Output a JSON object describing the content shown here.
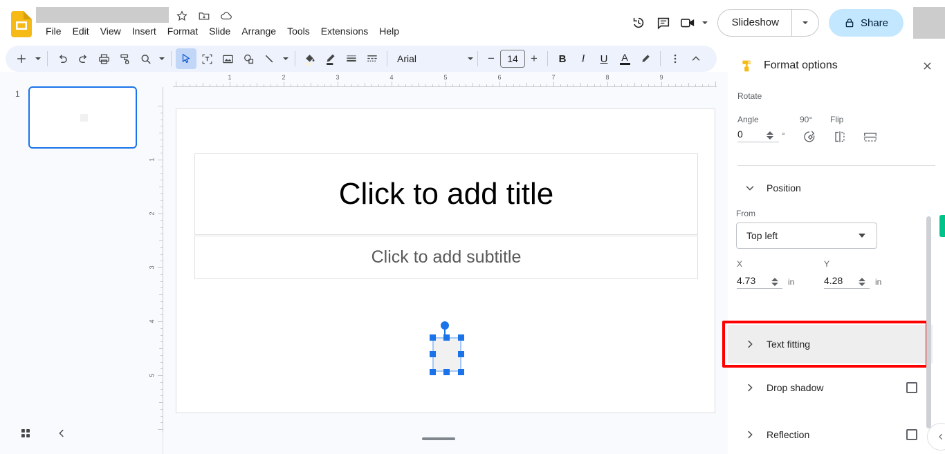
{
  "app": {
    "name": "Google Slides",
    "title_redacted": true
  },
  "header": {
    "icons": [
      {
        "name": "star-icon",
        "glyph": "☆"
      },
      {
        "name": "move-to-folder-icon",
        "glyph": "folder"
      },
      {
        "name": "cloud-saved-icon",
        "glyph": "cloud"
      }
    ],
    "menus": [
      {
        "label": "File"
      },
      {
        "label": "Edit"
      },
      {
        "label": "View"
      },
      {
        "label": "Insert"
      },
      {
        "label": "Format"
      },
      {
        "label": "Slide"
      },
      {
        "label": "Arrange"
      },
      {
        "label": "Tools"
      },
      {
        "label": "Extensions"
      },
      {
        "label": "Help"
      }
    ],
    "right": {
      "history_icon": "version-history-icon",
      "comment_icon": "comment-history-icon",
      "meet_icon": "google-meet-icon",
      "slideshow_label": "Slideshow",
      "share_label": "Share",
      "share_lock_icon": "lock-icon"
    }
  },
  "toolbar": {
    "new_slide_icon": "add-slide-icon",
    "undo_icon": "undo-icon",
    "redo_icon": "redo-icon",
    "print_icon": "print-icon",
    "paint_format_icon": "paint-format-icon",
    "zoom_icon": "zoom-icon",
    "select_icon": "select-tool-icon",
    "textbox_icon": "text-box-icon",
    "image_icon": "insert-image-icon",
    "shape_icon": "shape-icon",
    "line_icon": "line-icon",
    "fill_icon": "fill-color-icon",
    "border_color_icon": "border-color-icon",
    "border_weight_icon": "border-weight-icon",
    "border_dash_icon": "border-dash-icon",
    "font_name": "Arial",
    "font_size": "14",
    "decrease_font_label": "−",
    "increase_font_label": "+",
    "bold_label": "B",
    "italic_label": "I",
    "underline_label": "U",
    "text_color_label": "A",
    "highlight_icon": "highlight-color-icon",
    "more_icon": "more-options-icon",
    "collapse_icon": "collapse-toolbar-icon"
  },
  "filmstrip": {
    "slides": [
      {
        "number": "1",
        "selected": true
      }
    ],
    "grid_view_icon": "grid-view-icon",
    "collapse_icon": "collapse-filmstrip-icon"
  },
  "canvas": {
    "ruler_h_ticks": [
      "1",
      "2",
      "3",
      "4",
      "5",
      "6",
      "7",
      "8",
      "9"
    ],
    "ruler_v_ticks": [
      "1",
      "2",
      "3",
      "4",
      "5"
    ],
    "title_placeholder": "Click to add title",
    "subtitle_placeholder": "Click to add subtitle",
    "selected_shape": {
      "name": "selected-shape",
      "rotation_handle": true
    }
  },
  "format_options": {
    "panel_title": "Format options",
    "panel_icon": "format-paint-icon",
    "close_icon": "close-icon",
    "rotate": {
      "section_label": "Rotate",
      "angle_label": "Angle",
      "angle_value": "0",
      "degree_symbol": "°",
      "rotate90_label": "90°",
      "rotate90_icon": "rotate-90-icon",
      "flip_label": "Flip",
      "flip_horizontal_icon": "flip-horizontal-icon",
      "flip_vertical_icon": "flip-vertical-icon"
    },
    "position": {
      "section_label": "Position",
      "from_label": "From",
      "from_value": "Top left",
      "x_label": "X",
      "x_value": "4.73",
      "x_unit": "in",
      "y_label": "Y",
      "y_value": "4.28",
      "y_unit": "in"
    },
    "sections": [
      {
        "label": "Text fitting",
        "has_checkbox": false,
        "highlighted": true
      },
      {
        "label": "Drop shadow",
        "has_checkbox": true,
        "highlighted": false
      },
      {
        "label": "Reflection",
        "has_checkbox": true,
        "highlighted": false
      }
    ],
    "collapse_icon": "collapse-panel-icon"
  },
  "colors": {
    "accent_blue": "#1a73e8",
    "share_bg": "#c2e7ff",
    "toolbar_bg": "#edf2fc",
    "panel_bg": "#ffffff",
    "highlight_red": "#ff0000",
    "logo_yellow": "#f5ba15",
    "green_sliver": "#00c389"
  }
}
